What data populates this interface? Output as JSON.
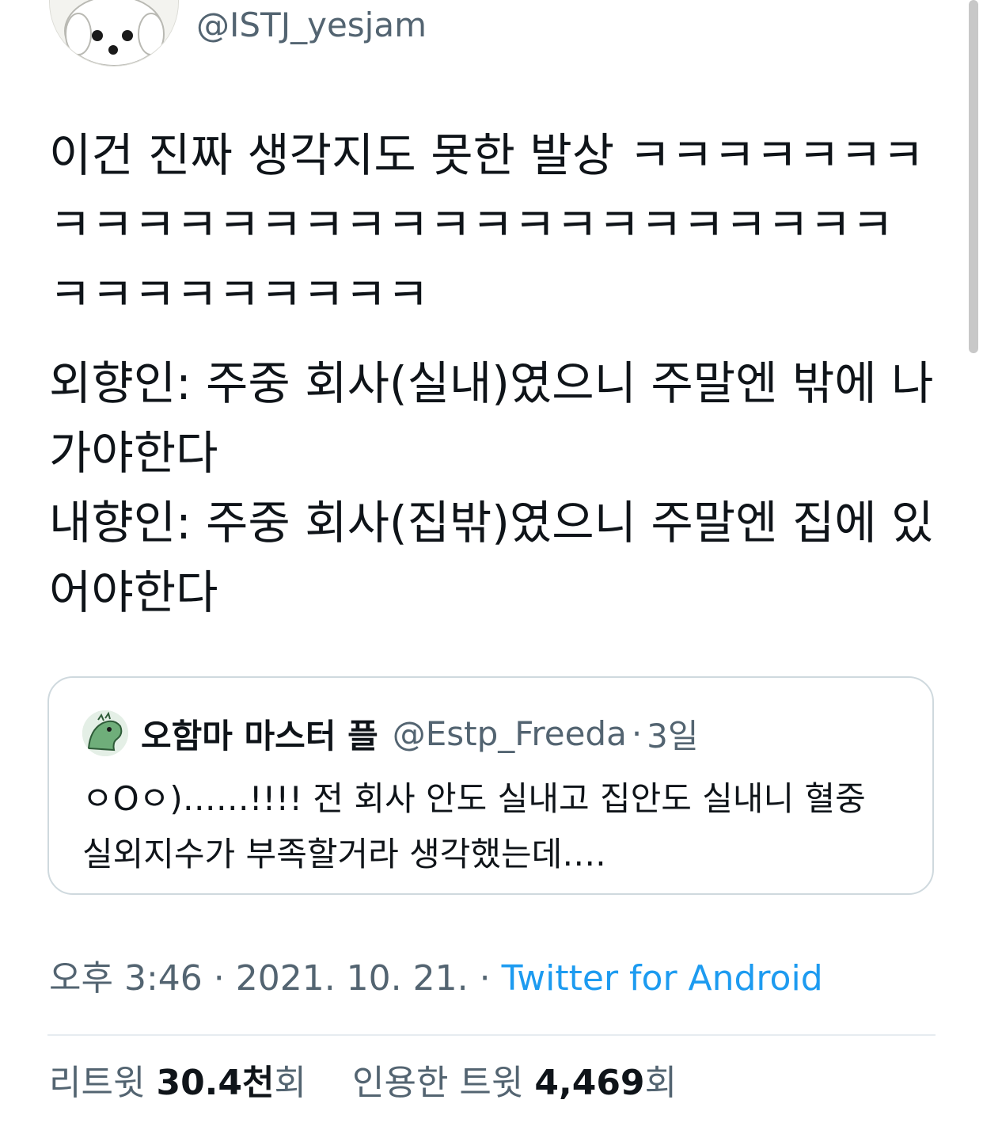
{
  "author": {
    "handle": "@ISTJ_yesjam",
    "avatar_icon": "white-dog-avatar"
  },
  "tweet": {
    "lines": [
      "이건 진짜 생각지도 못한 발상 ㅋㅋㅋㅋㅋㅋㅋㅋㅋㅋㅋㅋㅋㅋㅋㅋㅋㅋㅋㅋㅋㅋㅋㅋㅋㅋㅋㅋㅋㅋㅋㅋㅋㅋㅋㅋ",
      "외향인: 주중 회사(실내)였으니 주말엔 밖에 나가야한다",
      "내향인: 주중 회사(집밖)였으니 주말엔 집에 있어야한다"
    ]
  },
  "quote": {
    "name": "오함마 마스터 플",
    "handle": "@Estp_Freeda",
    "separator": "·",
    "time": "3일",
    "text": "ㅇOㅇ)……!!!! 전 회사 안도 실내고 집안도 실내니 혈중 실외지수가 부족할거라 생각했는데….",
    "avatar_icon": "green-dinosaur-avatar"
  },
  "meta": {
    "timestamp": "오후 3:46 · 2021. 10. 21. ·",
    "source": "Twitter for Android"
  },
  "stats": {
    "retweet_label": "리트윗",
    "retweet_count": "30.4천",
    "retweet_suffix": "회",
    "quote_label": "인용한 트윗",
    "quote_count": "4,469",
    "quote_suffix": "회"
  },
  "colors": {
    "link": "#1d9bf0",
    "secondary_text": "#536471",
    "border": "#cfd9de"
  }
}
